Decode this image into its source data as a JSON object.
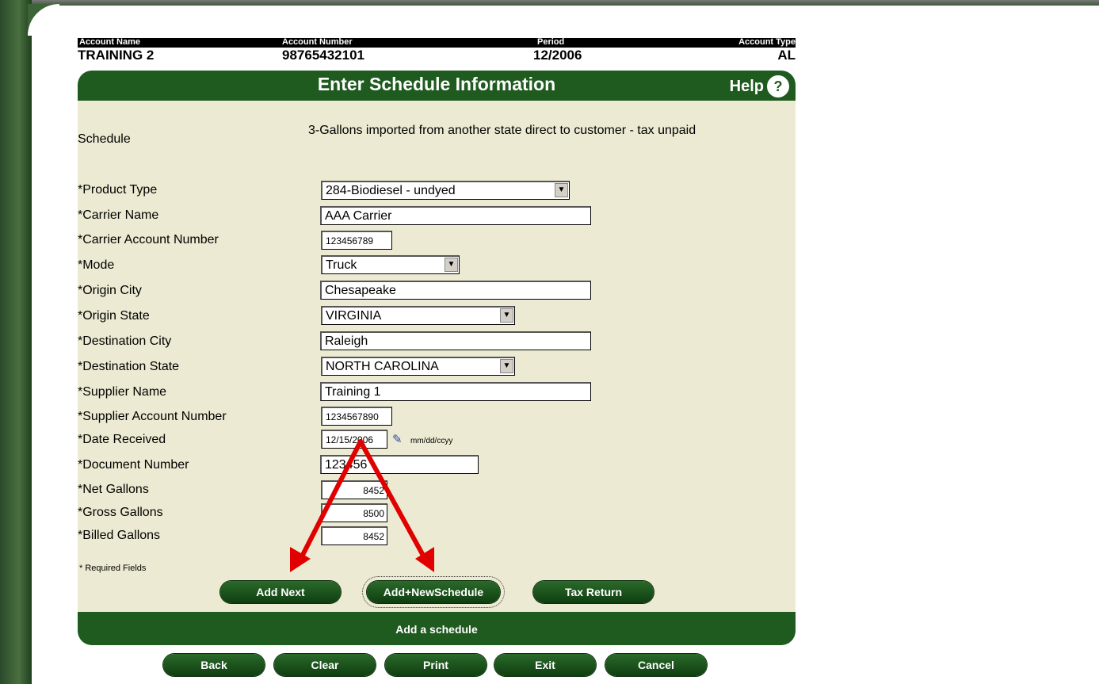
{
  "account": {
    "labels": {
      "name": "Account Name",
      "number": "Account Number",
      "period": "Period",
      "type": "Account Type"
    },
    "values": {
      "name": "TRAINING 2",
      "number": "98765432101",
      "period": "12/2006",
      "type": "AL"
    }
  },
  "title": "Enter Schedule Information",
  "help_label": "Help",
  "form": {
    "schedule_label": "Schedule",
    "schedule_value": "3-Gallons imported from another state direct to customer - tax unpaid",
    "fields": {
      "product_type": {
        "label": "*Product Type",
        "value": "284-Biodiesel - undyed"
      },
      "carrier_name": {
        "label": "*Carrier Name",
        "value": "AAA Carrier"
      },
      "carrier_account": {
        "label": "*Carrier Account Number",
        "value": "123456789"
      },
      "mode": {
        "label": "*Mode",
        "value": "Truck"
      },
      "origin_city": {
        "label": "*Origin City",
        "value": "Chesapeake"
      },
      "origin_state": {
        "label": "*Origin State",
        "value": "VIRGINIA"
      },
      "destination_city": {
        "label": "*Destination City",
        "value": "Raleigh"
      },
      "destination_state": {
        "label": "*Destination State",
        "value": "NORTH CAROLINA"
      },
      "supplier_name": {
        "label": "*Supplier Name",
        "value": "Training 1"
      },
      "supplier_account": {
        "label": "*Supplier Account Number",
        "value": "1234567890"
      },
      "date_received": {
        "label": "*Date Received",
        "value": "12/15/2006",
        "format_hint": "mm/dd/ccyy"
      },
      "document_number": {
        "label": "*Document Number",
        "value": "123456"
      },
      "net_gallons": {
        "label": "*Net Gallons",
        "value": "8452"
      },
      "gross_gallons": {
        "label": "*Gross Gallons",
        "value": "8500"
      },
      "billed_gallons": {
        "label": "*Billed Gallons",
        "value": "8452"
      }
    },
    "required_note": "* Required Fields"
  },
  "actions": {
    "add_next": "Add Next",
    "add_new_schedule": "Add+NewSchedule",
    "tax_return": "Tax Return"
  },
  "footer_text": "Add a schedule",
  "nav": {
    "back": "Back",
    "clear": "Clear",
    "print": "Print",
    "exit": "Exit",
    "cancel": "Cancel"
  },
  "colors": {
    "header_green": "#1f5a1f",
    "panel_bg": "#ecead2",
    "arrow_red": "#e00000"
  }
}
